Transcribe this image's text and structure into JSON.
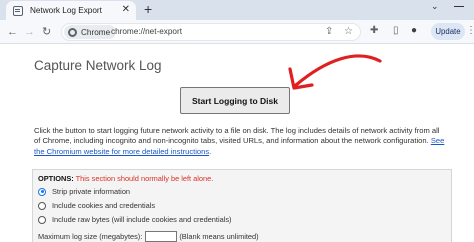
{
  "browser": {
    "tab": {
      "title": "Network Log Export"
    },
    "chip_label": "Chrome",
    "url": "chrome://net-export",
    "update_label": "Update",
    "icons": {
      "favicon": "document-icon",
      "close": "close-icon",
      "new_tab": "plus-icon",
      "tab_search": "chevron-down-icon",
      "back": "back-arrow-icon",
      "forward": "forward-arrow-icon",
      "reload": "reload-icon",
      "share": "share-icon",
      "bookmark": "star-icon",
      "extensions": "puzzle-icon",
      "sidebar": "sidebar-icon",
      "profile": "profile-icon",
      "menu": "kebab-icon"
    },
    "glyphs": {
      "close": "✕",
      "new_tab": "+",
      "tab_search": "⌄",
      "back": "←",
      "forward": "→",
      "reload": "↻",
      "share": "⇪",
      "bookmark": "☆",
      "extensions": "✚",
      "sidebar": "▯",
      "profile": "●",
      "menu": "⋮"
    }
  },
  "page": {
    "title": "Capture Network Log",
    "start_button": "Start Logging to Disk",
    "description": "Click the button to start logging future network activity to a file on disk. The log includes details of network activity from all of Chrome, including incognito and non-incognito tabs, visited URLs, and information about the network configuration.",
    "description_link": "See the Chromium website for more detailed instructions",
    "description_end": ".",
    "options": {
      "header": "OPTIONS",
      "header_sep": ":",
      "warning": "This section should normally be left alone.",
      "radio": [
        {
          "label": "Strip private information",
          "checked": true
        },
        {
          "label": "Include cookies and credentials",
          "checked": false
        },
        {
          "label": "Include raw bytes (will include cookies and credentials)",
          "checked": false
        }
      ],
      "max_size_label": "Maximum log size (megabytes):",
      "max_size_value": "",
      "max_size_hint": "(Blank means unlimited)"
    },
    "annotation_color": "#e02020"
  }
}
